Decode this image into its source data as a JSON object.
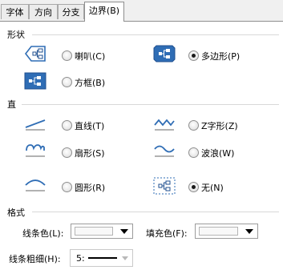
{
  "tabs": [
    {
      "label": "字体",
      "active": false
    },
    {
      "label": "方向",
      "active": false
    },
    {
      "label": "分支",
      "active": false
    },
    {
      "label": "边界(B)",
      "active": true
    }
  ],
  "sections": {
    "shape": "形状",
    "line": "直",
    "format": "格式"
  },
  "shape_options": {
    "balloon": {
      "label": "喇叭(C)",
      "checked": false,
      "icon": "balloon-shape-icon"
    },
    "polygon": {
      "label": "多边形(P)",
      "checked": true,
      "icon": "polygon-shape-icon"
    },
    "rectangle": {
      "label": "方框(B)",
      "checked": false,
      "icon": "rectangle-shape-icon"
    }
  },
  "line_options": {
    "straight": {
      "label": "直线(T)",
      "checked": false,
      "icon": "straight-line-icon"
    },
    "zigzag": {
      "label": "Z字形(Z)",
      "checked": false,
      "icon": "zigzag-line-icon"
    },
    "scallop": {
      "label": "扇形(S)",
      "checked": false,
      "icon": "scallop-line-icon"
    },
    "wave": {
      "label": "波浪(W)",
      "checked": false,
      "icon": "wave-line-icon"
    },
    "arc": {
      "label": "圆形(R)",
      "checked": false,
      "icon": "arc-line-icon"
    },
    "none": {
      "label": "无(N)",
      "checked": true,
      "icon": "no-line-icon"
    }
  },
  "format": {
    "line_color_label": "线条色(L):",
    "fill_color_label": "填充色(F):",
    "line_weight_label": "线条粗细(H):",
    "line_weight_value": "5:"
  },
  "colors": {
    "icon_blue": "#2f6db5",
    "icon_blue_dark": "#1f4f8f",
    "tab_border": "#8e8e8e"
  }
}
